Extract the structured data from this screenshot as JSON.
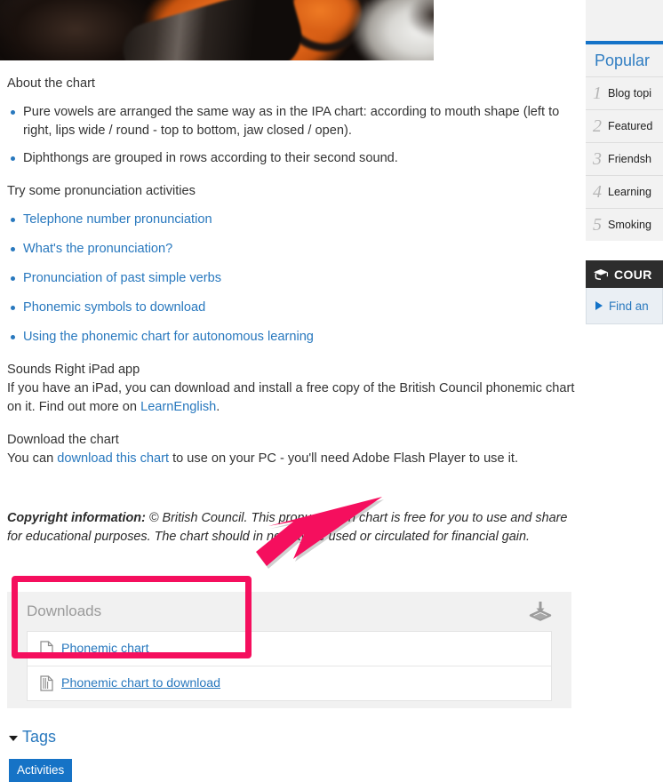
{
  "hero": {
    "alt": "blurred photo of person wearing leather jacket with orange background"
  },
  "article": {
    "about_heading": "About the chart",
    "about_bullets": [
      "Pure vowels are arranged the same way as in the IPA chart: according to mouth shape (left to right, lips wide / round - top to bottom, jaw closed / open).",
      "Diphthongs are grouped in rows according to their second sound."
    ],
    "activities_heading": "Try some pronunciation activities",
    "activity_links": [
      "Telephone number pronunciation",
      "What's the pronunciation?",
      "Pronunciation of past simple verbs",
      "Phonemic symbols to download",
      "Using the phonemic chart for autonomous learning"
    ],
    "ipad_heading": "Sounds Right iPad app",
    "ipad_text_before": "If you have an iPad, you can download and install a free copy of the British Council phonemic chart on it. Find out more on ",
    "ipad_link": "LearnEnglish",
    "ipad_text_after": ".",
    "download_heading": "Download the chart",
    "download_text_before": "You can ",
    "download_link": "download this chart",
    "download_text_after": " to use on your PC - you'll need Adobe Flash Player to use it.",
    "copyright_label": "Copyright information:",
    "copyright_text": " © British Council. This pronunciation chart is free for you to use and share for educational purposes. The chart should in no way be used or circulated for financial gain."
  },
  "downloads": {
    "title": "Downloads",
    "icon": "download-tray-icon",
    "rows": [
      {
        "icon": "file-document-icon",
        "label": "Phonemic chart",
        "underlined": false
      },
      {
        "icon": "file-archive-icon",
        "label": "Phonemic chart to download",
        "underlined": true
      }
    ]
  },
  "annotations": {
    "highlight_color": "#f50f5e",
    "arrow_color": "#f50f5e",
    "highlight_target": "downloads-rows",
    "arrow_points_to": "downloads-panel"
  },
  "tags": {
    "title": "Tags",
    "toggle_icon": "chevron-down-icon",
    "chips": [
      "Activities"
    ]
  },
  "sidebar": {
    "popular": {
      "title": "Popular",
      "items": [
        {
          "rank": "1",
          "label": "Blog topi"
        },
        {
          "rank": "2",
          "label": "Featured"
        },
        {
          "rank": "3",
          "label": "Friendsh"
        },
        {
          "rank": "4",
          "label": "Learning"
        },
        {
          "rank": "5",
          "label": "Smoking"
        }
      ]
    },
    "courses": {
      "icon": "graduation-cap-icon",
      "title": "COUR",
      "link": "Find an",
      "bullet_icon": "triangle-right-icon"
    }
  },
  "colors": {
    "link_blue": "#2878be",
    "accent_blue": "#1473c8",
    "pink": "#f50f5e",
    "panel_gray": "#f1f1f1",
    "dark_header": "#2d2d2d"
  }
}
